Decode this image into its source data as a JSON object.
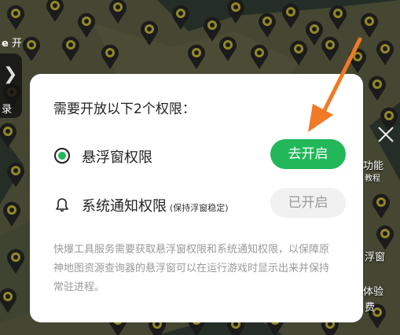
{
  "side": {
    "left_top_text": "𝗲 开",
    "left_mid_text": "录",
    "right_1": "功能",
    "right_1b": "教程",
    "right_2": "浮窗",
    "right_3": "体验",
    "right_3b": "费"
  },
  "dialog": {
    "title": "需要开放以下2个权限：",
    "permissions": [
      {
        "label": "悬浮窗权限",
        "note": "",
        "button": "去开启",
        "state": "enable",
        "icon": "radio-icon"
      },
      {
        "label": "系统通知权限",
        "note": "(保持浮窗稳定)",
        "button": "已开启",
        "state": "enabled",
        "icon": "bell-icon"
      }
    ],
    "description": "快爆工具服务需要获取悬浮窗权限和系统通知权限，以保障原神地图资源查询器的悬浮窗可以在运行游戏时显示出来并保持常驻进程。"
  },
  "colors": {
    "accent": "#22b85a",
    "arrow": "#f07a25",
    "disabled_bg": "#f1f1f1",
    "disabled_text": "#9a9a9a"
  }
}
